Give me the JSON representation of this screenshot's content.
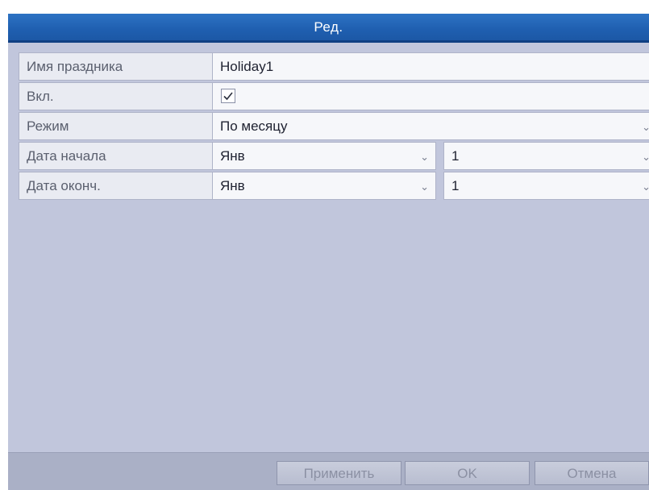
{
  "dialog": {
    "title": "Ред."
  },
  "form": {
    "rows": [
      {
        "label": "Имя праздника",
        "value": "Holiday1"
      },
      {
        "label": "Вкл.",
        "checked": true
      },
      {
        "label": "Режим",
        "value": "По месяцу"
      },
      {
        "label": "Дата начала",
        "month": "Янв",
        "day": "1"
      },
      {
        "label": "Дата оконч.",
        "month": "Янв",
        "day": "1"
      }
    ]
  },
  "buttons": {
    "apply": "Применить",
    "ok": "OK",
    "cancel": "Отмена"
  },
  "icons": {
    "dropdown": "chevron-down-icon",
    "check": "checkmark-icon"
  }
}
